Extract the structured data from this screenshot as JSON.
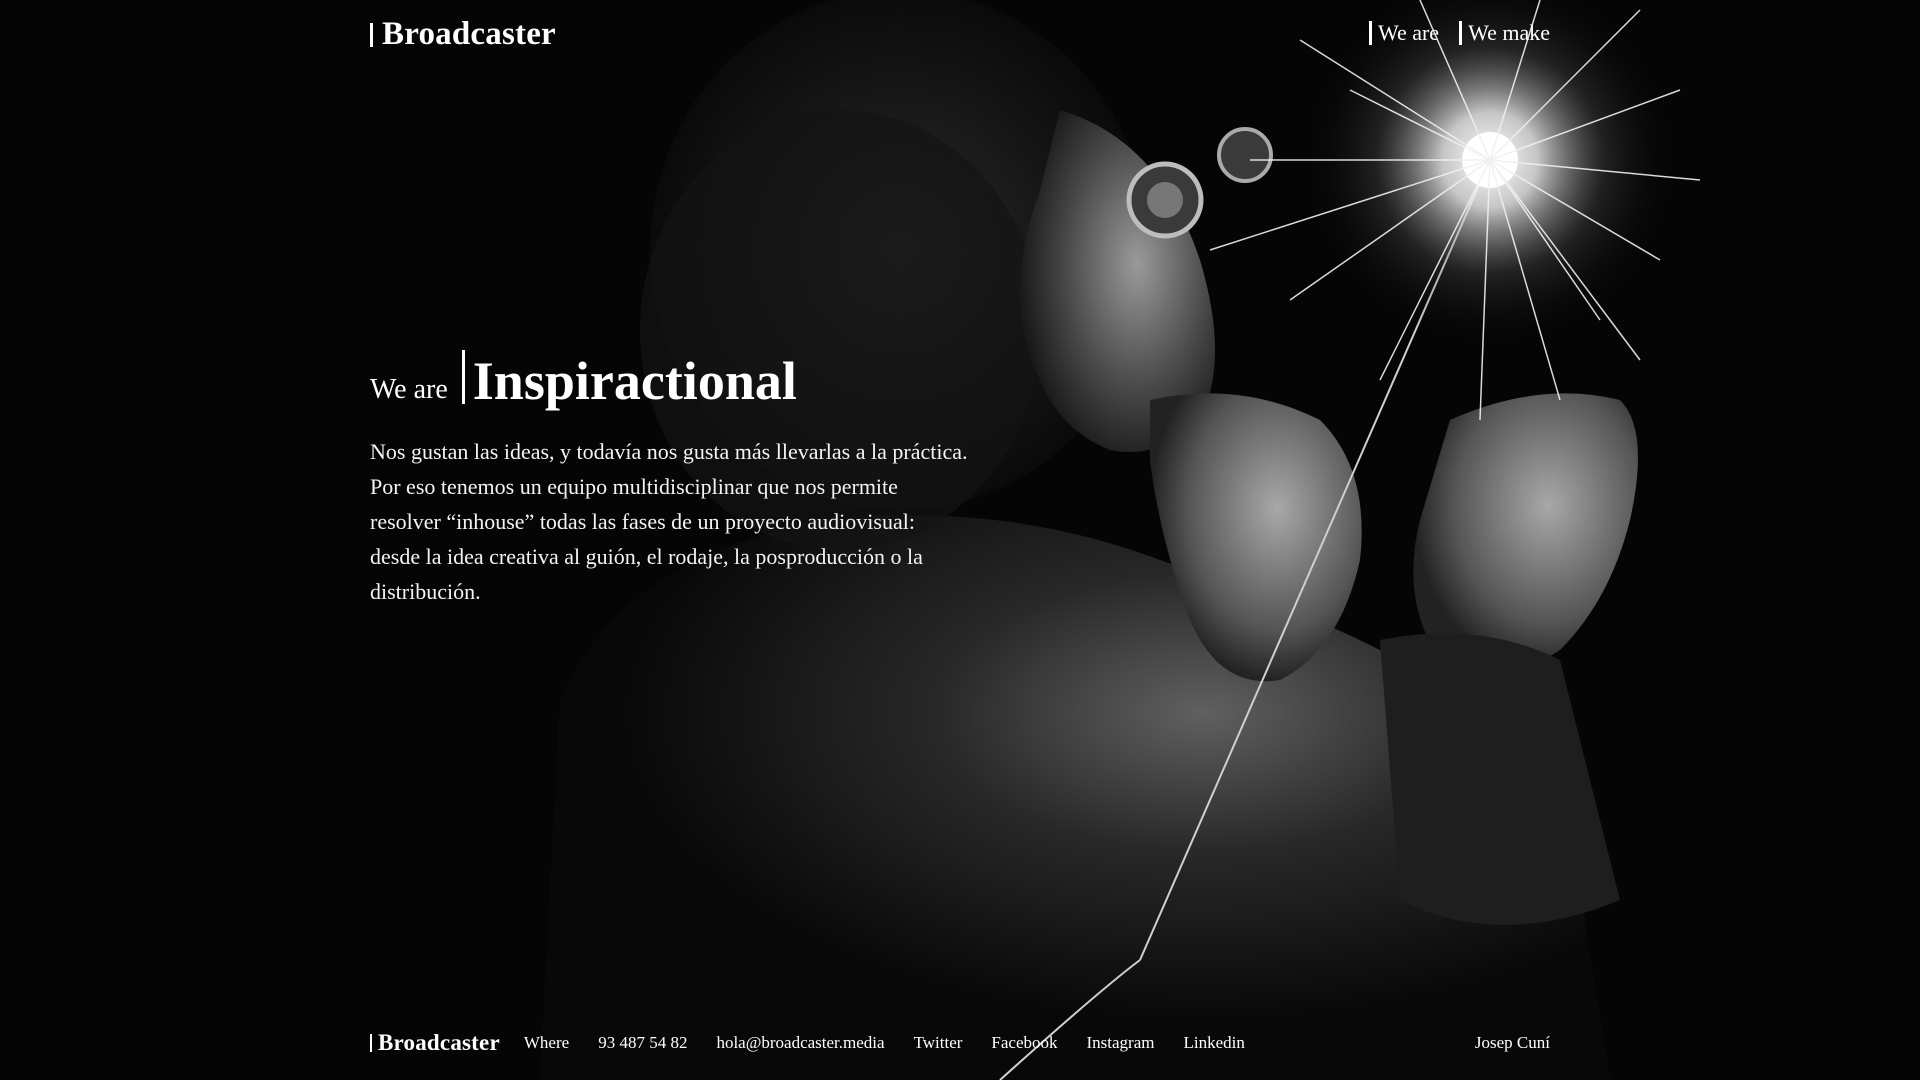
{
  "brand": {
    "name": "Broadcaster"
  },
  "nav": {
    "items": [
      {
        "label": "We are"
      },
      {
        "label": "We make"
      }
    ]
  },
  "hero": {
    "prefix": "We are",
    "word": "Inspiractional",
    "body": "Nos gustan las ideas, y todavía nos gusta más llevarlas a la práctica. Por eso tenemos un equipo multidisciplinar que nos permite resolver “inhouse” todas las fases de un proyecto audiovisual: desde la idea creativa al guión, el rodaje, la posproducción o la distribución."
  },
  "footer": {
    "links": [
      {
        "label": "Where"
      },
      {
        "label": "93 487 54 82"
      },
      {
        "label": "hola@broadcaster.media"
      },
      {
        "label": "Twitter"
      },
      {
        "label": "Facebook"
      },
      {
        "label": "Instagram"
      },
      {
        "label": "Linkedin"
      }
    ],
    "credit": "Josep Cuní"
  },
  "colors": {
    "background": "#050505",
    "text": "#ffffff"
  }
}
